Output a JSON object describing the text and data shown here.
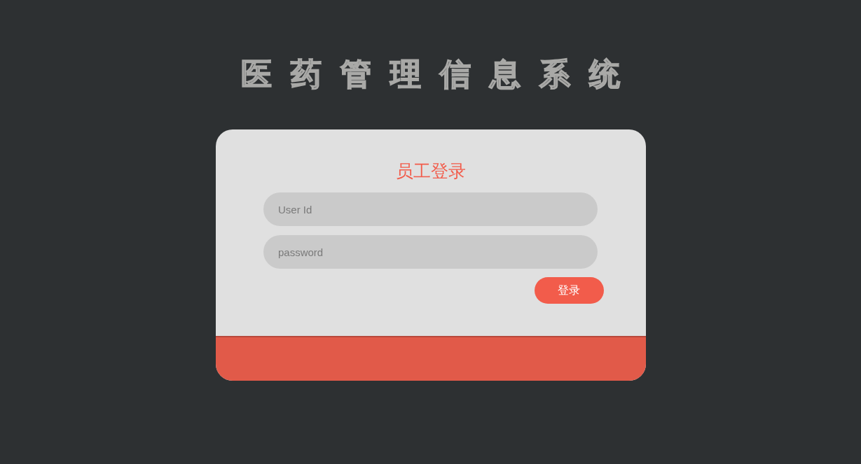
{
  "title": "医药管理信息系统",
  "login": {
    "heading": "员工登录",
    "fields": [
      {
        "placeholder": "User Id"
      },
      {
        "placeholder": "password"
      }
    ],
    "button": "登录"
  }
}
